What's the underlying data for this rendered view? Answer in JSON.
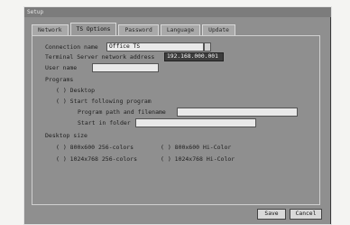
{
  "window": {
    "title": "Setup"
  },
  "tabs": [
    "Network",
    "TS Options",
    "Password",
    "Language",
    "Update"
  ],
  "active_tab": "TS Options",
  "connection": {
    "name_label": "Connection name",
    "name_value": "Office TS",
    "address_label": "Terminal Server network address",
    "address_value": "192.168.000.001",
    "user_label": "User name",
    "user_value": ""
  },
  "programs": {
    "heading": "Programs",
    "opt_desktop": "( ) Desktop",
    "opt_start": "( ) Start following program",
    "path_label": "Program path and filename",
    "path_value": "",
    "folder_label": "Start in folder",
    "folder_value": ""
  },
  "desktop_size": {
    "heading": "Desktop size",
    "opt1": "( ) 800x600 256-colors",
    "opt2": "( ) 800x600 Hi-Color",
    "opt3": "( ) 1024x768 256-colors",
    "opt4": "( ) 1024x768 Hi-Color"
  },
  "buttons": {
    "save": "Save",
    "cancel": "Cancel"
  }
}
